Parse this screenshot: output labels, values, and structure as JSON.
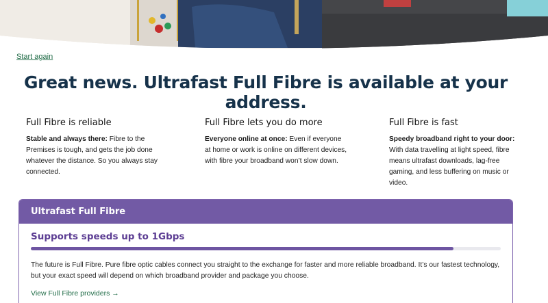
{
  "colors": {
    "accent_purple": "#725aa5",
    "link_green": "#1f6b46",
    "heading_navy": "#16324a"
  },
  "nav": {
    "start_again": "Start again"
  },
  "headline": "Great news. Ultrafast Full Fibre is available at your address.",
  "features": [
    {
      "title": "Full Fibre is reliable",
      "lead": "Stable and always there:",
      "text": " Fibre to the Premises is tough, and gets the job done whatever the distance. So you always stay connected."
    },
    {
      "title": "Full Fibre lets you do more",
      "lead": "Everyone online at once:",
      "text": " Even if everyone at home or work is online on different devices, with fibre your broadband won’t slow down."
    },
    {
      "title": "Full Fibre is fast",
      "lead": "Speedy broadband right to your door:",
      "text": " With data travelling at light speed, fibre means ultrafast downloads, lag-free gaming, and less buffering on music or video."
    }
  ],
  "card": {
    "title": "Ultrafast Full Fibre",
    "speed_label": "Supports speeds up to 1Gbps",
    "speed_fraction": 0.9,
    "description": "The future is Full Fibre. Pure fibre optic cables connect you straight to the exchange for faster and more reliable broadband. It’s our fastest technology, but your exact speed will depend on which broadband provider and package you choose.",
    "link": "View Full Fibre providers →"
  }
}
